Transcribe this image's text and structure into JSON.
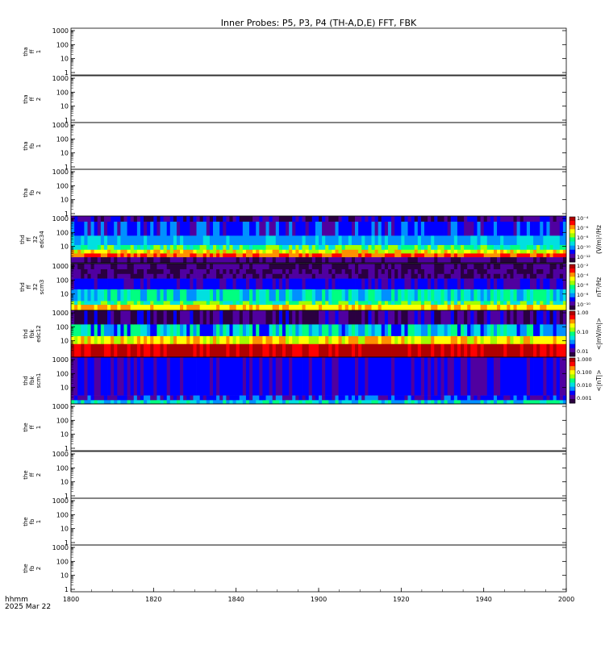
{
  "chart_data": {
    "type": "heatmap",
    "title": "Inner Probes: P5, P3, P4 (TH-A,D,E) FFT, FBK",
    "x_tick_labels": [
      "1800",
      "1820",
      "1840",
      "1900",
      "1920",
      "1940",
      "2000"
    ],
    "x_range_label": [
      "1800",
      "2000"
    ],
    "footer_lines": [
      "hhmm",
      "2025 Mar 22"
    ],
    "panels": [
      {
        "id": "tha-ff-1",
        "ylabel": [
          "tha",
          "ff",
          "1"
        ],
        "y_ticks": [
          "1000",
          "100",
          "10",
          "1"
        ],
        "spectrogram": false
      },
      {
        "id": "tha-ff-2",
        "ylabel": [
          "tha",
          "ff",
          "2"
        ],
        "y_ticks": [
          "1000",
          "100",
          "10",
          "1"
        ],
        "spectrogram": false
      },
      {
        "id": "tha-fb-1",
        "ylabel": [
          "tha",
          "fb",
          "1"
        ],
        "y_ticks": [
          "1000",
          "100",
          "10",
          "1"
        ],
        "spectrogram": false
      },
      {
        "id": "tha-fb-2",
        "ylabel": [
          "tha",
          "fb",
          "2"
        ],
        "y_ticks": [
          "1000",
          "100",
          "10",
          "1"
        ],
        "spectrogram": false
      },
      {
        "id": "thd-ff32-edc34",
        "ylabel": [
          "thd",
          "ff",
          "32",
          "edc34"
        ],
        "y_ticks": [
          "1000",
          "100",
          "10"
        ],
        "spectrogram": true,
        "colorbar": {
          "unit": "(V/m)²/Hz",
          "labels": [
            "10⁻⁴",
            "10⁻⁶",
            "10⁻⁸",
            "10⁻¹⁰",
            "10⁻¹²"
          ]
        }
      },
      {
        "id": "thd-ff32-scm3",
        "ylabel": [
          "thd",
          "ff",
          "32",
          "scm3"
        ],
        "y_ticks": [
          "1000",
          "100",
          "10"
        ],
        "spectrogram": true,
        "colorbar": {
          "unit": "nT²/Hz",
          "labels": [
            "10⁻²",
            "10⁻⁴",
            "10⁻⁶",
            "10⁻⁸",
            "10⁻¹⁰"
          ]
        }
      },
      {
        "id": "thd-fbk-edc12",
        "ylabel": [
          "thd",
          "fbk",
          "edc12"
        ],
        "y_ticks": [
          "1000",
          "100",
          "10"
        ],
        "spectrogram": true,
        "colorbar": {
          "unit": "<|mV/m|>",
          "labels": [
            "1.00",
            "0.10",
            "0.01"
          ]
        }
      },
      {
        "id": "thd-fbk-scm1",
        "ylabel": [
          "thd",
          "fbk",
          "scm1"
        ],
        "y_ticks": [
          "1000",
          "100",
          "10"
        ],
        "spectrogram": true,
        "colorbar": {
          "unit": "<|nT|>",
          "labels": [
            "1.000",
            "0.100",
            "0.010",
            "0.001"
          ]
        }
      },
      {
        "id": "the-ff-1",
        "ylabel": [
          "the",
          "ff",
          "1"
        ],
        "y_ticks": [
          "1000",
          "100",
          "10",
          "1"
        ],
        "spectrogram": false
      },
      {
        "id": "the-ff-2",
        "ylabel": [
          "the",
          "ff",
          "2"
        ],
        "y_ticks": [
          "1000",
          "100",
          "10",
          "1"
        ],
        "spectrogram": false
      },
      {
        "id": "the-fb-1",
        "ylabel": [
          "the",
          "fb",
          "1"
        ],
        "y_ticks": [
          "1000",
          "100",
          "10",
          "1"
        ],
        "spectrogram": false
      },
      {
        "id": "the-fb-2",
        "ylabel": [
          "the",
          "fb",
          "2"
        ],
        "y_ticks": [
          "1000",
          "100",
          "10",
          "1"
        ],
        "spectrogram": false
      }
    ],
    "colormap": [
      "#2a0040",
      "#5000a0",
      "#0000ff",
      "#0090ff",
      "#00e0e0",
      "#00ff80",
      "#a0ff00",
      "#ffff00",
      "#ff9000",
      "#ff0000",
      "#b00000"
    ]
  }
}
